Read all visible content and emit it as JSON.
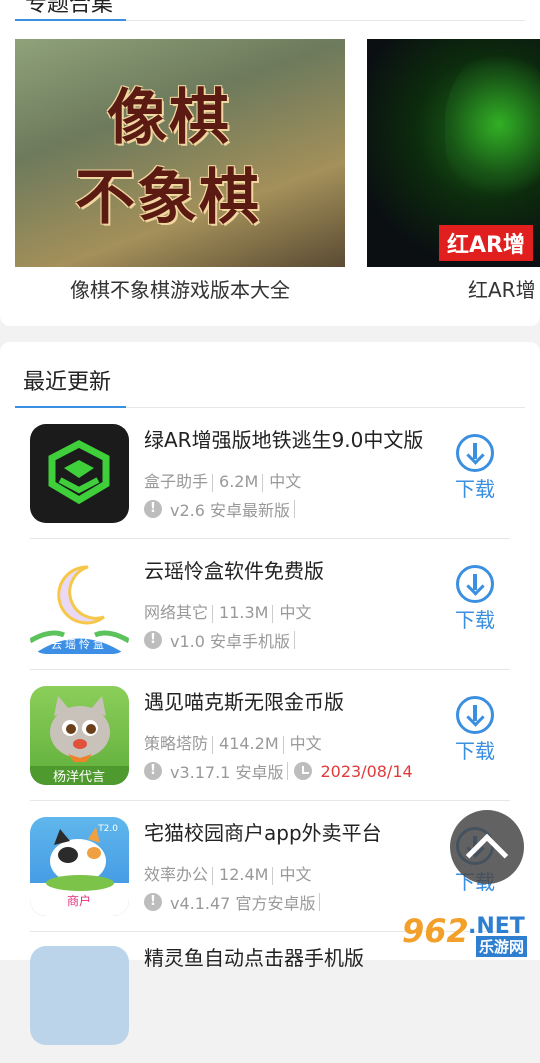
{
  "top": {
    "section_title_cut": "专题合集",
    "banners": [
      {
        "lines": [
          "像棋",
          "不象棋"
        ],
        "caption": "像棋不象棋游戏版本大全"
      },
      {
        "tag": "红AR增",
        "caption": "红AR增"
      }
    ]
  },
  "recent": {
    "title": "最近更新",
    "items": [
      {
        "name": "绿AR增强版地铁逃生9.0中文版",
        "category": "盒子助手",
        "size": "6.2M",
        "lang": "中文",
        "version": "v2.6 安卓最新版",
        "date": "",
        "download": "下载"
      },
      {
        "name": "云瑶怜盒软件免费版",
        "category": "网络其它",
        "size": "11.3M",
        "lang": "中文",
        "version": "v1.0 安卓手机版",
        "date": "",
        "download": "下载",
        "icon_text": "云瑶怜盒"
      },
      {
        "name": "遇见喵克斯无限金币版",
        "category": "策略塔防",
        "size": "414.2M",
        "lang": "中文",
        "version": "v3.17.1 安卓版",
        "date": "2023/08/14",
        "download": "下载",
        "icon_text": "杨洋代言"
      },
      {
        "name": "宅猫校园商户app外卖平台",
        "category": "效率办公",
        "size": "12.4M",
        "lang": "中文",
        "version": "v4.1.47 官方安卓版",
        "date": "",
        "download": "下载",
        "icon_text": "商户",
        "icon_badge": "T2.0"
      },
      {
        "name": "精灵鱼自动点击器手机版"
      }
    ]
  },
  "watermark": {
    "brand": "962",
    "net": ".NET",
    "site": "乐游网"
  },
  "colors": {
    "accent": "#3b8fe0",
    "date": "#e03a3a"
  }
}
